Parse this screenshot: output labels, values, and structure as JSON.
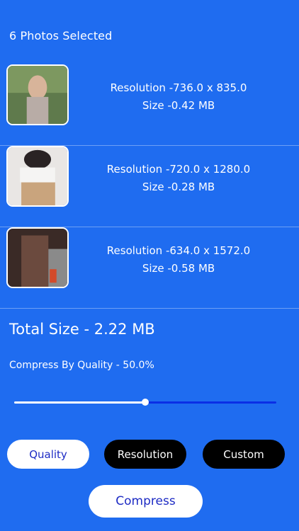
{
  "header": {
    "title": "6 Photos Selected"
  },
  "photos": [
    {
      "resolution": "Resolution -736.0 x 835.0",
      "size": "Size -0.42 MB",
      "thumb_icon": "photo-thumbnail-icon"
    },
    {
      "resolution": "Resolution -720.0 x 1280.0",
      "size": "Size -0.28 MB",
      "thumb_icon": "photo-thumbnail-icon"
    },
    {
      "resolution": "Resolution -634.0 x 1572.0",
      "size": "Size -0.58 MB",
      "thumb_icon": "photo-thumbnail-icon"
    }
  ],
  "summary": {
    "total_size": "Total Size - 2.22 MB",
    "quality_label": "Compress By Quality - 50.0%",
    "quality_value": 0.5
  },
  "modes": {
    "quality": "Quality",
    "resolution": "Resolution",
    "custom": "Custom"
  },
  "actions": {
    "compress": "Compress"
  },
  "colors": {
    "background": "#1f6cf0",
    "accent_text": "#1d2bc4",
    "slider_inactive": "#0a2ee6"
  }
}
